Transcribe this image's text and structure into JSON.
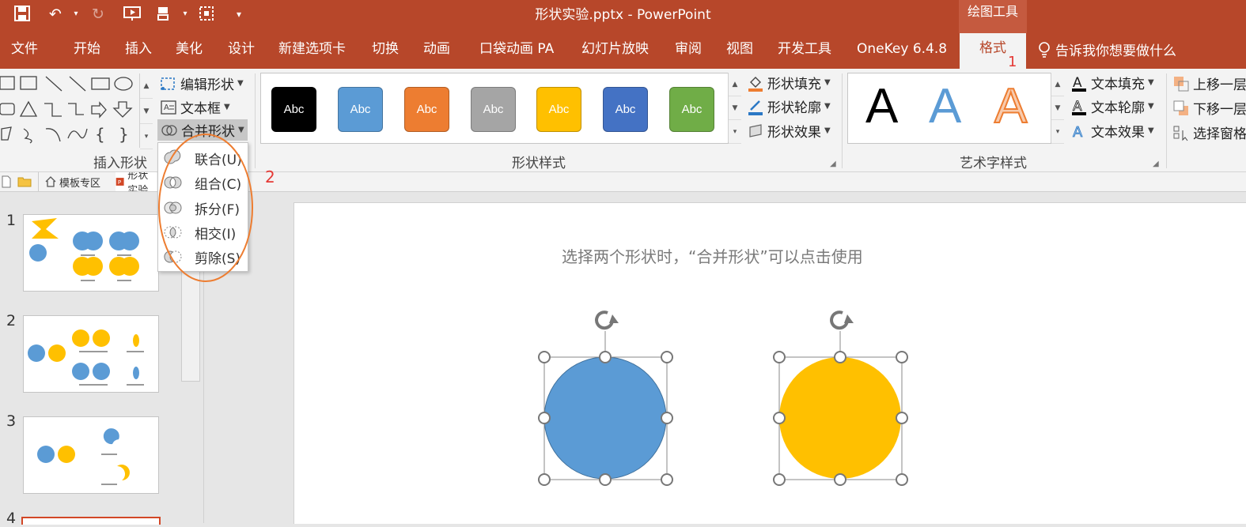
{
  "window": {
    "title": "形状实验.pptx - PowerPoint",
    "context_label": "绘图工具"
  },
  "tabs": [
    {
      "label": "文件"
    },
    {
      "label": "开始"
    },
    {
      "label": "插入"
    },
    {
      "label": "美化"
    },
    {
      "label": "设计"
    },
    {
      "label": "新建选项卡"
    },
    {
      "label": "切换"
    },
    {
      "label": "动画"
    },
    {
      "label": "口袋动画 PA"
    },
    {
      "label": "幻灯片放映"
    },
    {
      "label": "审阅"
    },
    {
      "label": "视图"
    },
    {
      "label": "开发工具"
    },
    {
      "label": "OneKey 6.4.8"
    },
    {
      "label": "格式"
    }
  ],
  "tell_me": "告诉我你想要做什么",
  "annotations": {
    "one": "1",
    "two": "2"
  },
  "ribbon": {
    "insert_shapes": {
      "label": "插入形状",
      "edit_shape": "编辑形状",
      "text_box": "文本框",
      "merge_shapes": "合并形状"
    },
    "shape_styles": {
      "label": "形状样式",
      "swatch_text": "Abc",
      "colors": [
        "#000000",
        "#5b9bd5",
        "#ed7d31",
        "#a5a5a5",
        "#ffc000",
        "#4472c4",
        "#70ad47"
      ],
      "fill": "形状填充",
      "outline": "形状轮廓",
      "effects": "形状效果"
    },
    "wordart": {
      "label": "艺术字样式",
      "letter": "A",
      "text_fill": "文本填充",
      "text_outline": "文本轮廓",
      "text_effects": "文本效果"
    },
    "arrange": {
      "bring_forward": "上移一层",
      "send_backward": "下移一层",
      "selection_pane": "选择窗格"
    }
  },
  "merge_menu": [
    {
      "label": "联合(U)"
    },
    {
      "label": "组合(C)"
    },
    {
      "label": "拆分(F)"
    },
    {
      "label": "相交(I)"
    },
    {
      "label": "剪除(S)"
    }
  ],
  "doc_tabs": {
    "template": "模板专区",
    "file": "形状实验"
  },
  "slides": [
    "1",
    "2",
    "3",
    "4"
  ],
  "slide": {
    "caption": "选择两个形状时，“合并形状”可以点击使用",
    "circle_colors": {
      "blue": "#5b9bd5",
      "yellow": "#ffc000"
    }
  },
  "colors": {
    "accent": "#b7472a",
    "annotation": "#e53935",
    "ellipse": "#ed7d31"
  }
}
